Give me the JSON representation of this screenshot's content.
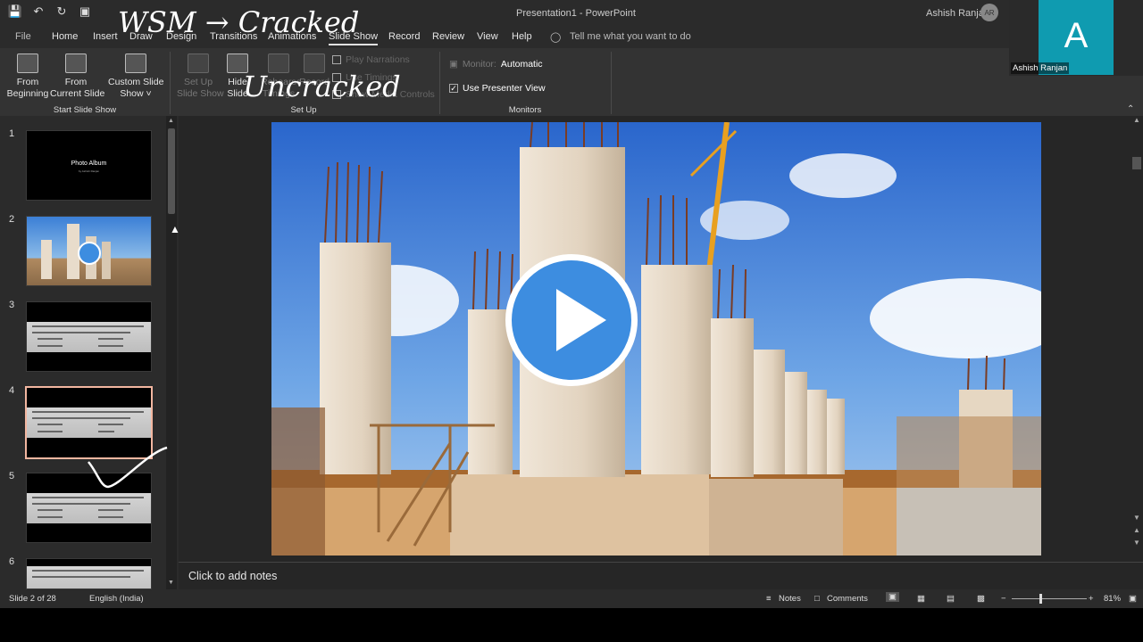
{
  "app": {
    "doc_title": "Presentation1  -  PowerPoint",
    "user_name": "Ashish Ranjan",
    "user_initials": "AR"
  },
  "qat_icons": [
    "save-icon",
    "undo-icon",
    "redo-icon",
    "present-icon"
  ],
  "tabs": [
    "File",
    "Home",
    "Insert",
    "Draw",
    "Design",
    "Transitions",
    "Animations",
    "Slide Show",
    "Record",
    "Review",
    "View",
    "Help"
  ],
  "active_tab": "Slide Show",
  "tell_me": "Tell me what you want to do",
  "ribbon": {
    "from_beginning": "From\nBeginning",
    "from_current": "From\nCurrent Slide",
    "custom_show": "Custom Slide\nShow ˅",
    "start_group": "Start Slide Show",
    "set_up_show": "Set Up\nSlide Show",
    "hide_slide": "Hide\nSlide",
    "rehearse": "Rehearse\nTimings",
    "record": "Record",
    "play_narrations": "Play Narrations",
    "use_timings": "Use Timings",
    "show_media": "Show Media Controls",
    "setup_group": "Set Up",
    "monitor_label": "Monitor:",
    "monitor_value": "Automatic",
    "presenter_view": "Use Presenter View",
    "monitors_group": "Monitors"
  },
  "thumbnails": [
    {
      "num": "1",
      "title": "Photo Album",
      "sub": "by Ashish Ranjan"
    },
    {
      "num": "2"
    },
    {
      "num": "3"
    },
    {
      "num": "4"
    },
    {
      "num": "5"
    },
    {
      "num": "6"
    }
  ],
  "notes_placeholder": "Click to add notes",
  "status": {
    "slide": "Slide 2 of 28",
    "language": "English (India)",
    "notes": "Notes",
    "comments": "Comments",
    "zoom": "81%"
  },
  "webcam": {
    "letter": "A",
    "name": "Ashish Ranjan"
  },
  "ink": {
    "line1": "WSM → Cracked",
    "line2": "Uncracked"
  },
  "colors": {
    "ribbon": "#333333",
    "sky": "#2f6fd0",
    "play": "#3d8de0",
    "webcam": "#0f9bb0",
    "selected_border": "#f2b6a0"
  }
}
